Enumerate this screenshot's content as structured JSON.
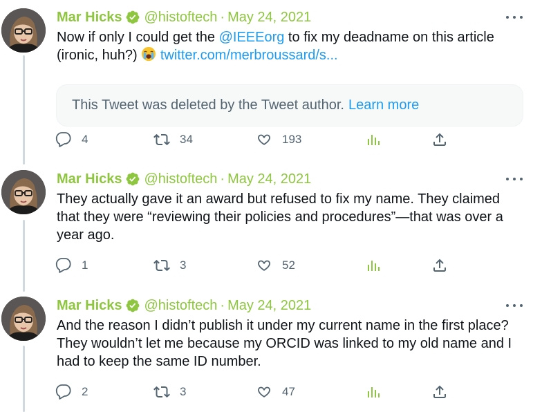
{
  "tweets": [
    {
      "name": "Mar Hicks",
      "handle": "@histoftech",
      "separator": "·",
      "date": "May 24, 2021",
      "text_parts": {
        "a": "Now if only I could get the ",
        "mention": "@IEEEorg",
        "b": " to fix my deadname on this article",
        "c": "(ironic, huh?) ",
        "emoji": "loudly-crying-face",
        "url": "twitter.com/merbroussard/s..."
      },
      "quote": {
        "text": "This Tweet was deleted by the Tweet author.",
        "link": "Learn more"
      },
      "replies": "4",
      "retweets": "34",
      "likes": "193"
    },
    {
      "name": "Mar Hicks",
      "handle": "@histoftech",
      "separator": "·",
      "date": "May 24, 2021",
      "text_lines": [
        "They actually gave it an award but refused to fix my name. They claimed",
        "that they were “reviewing their policies and procedures”—that was over a",
        "year ago."
      ],
      "replies": "1",
      "retweets": "3",
      "likes": "52"
    },
    {
      "name": "Mar Hicks",
      "handle": "@histoftech",
      "separator": "·",
      "date": "May 24, 2021",
      "text_lines": [
        "And the reason I didn’t publish it under my current name in the first place?",
        "They wouldn’t let me because my ORCID was linked to my old name and I",
        "had to keep the same ID number."
      ],
      "replies": "2",
      "retweets": "3",
      "likes": "47"
    }
  ],
  "colors": {
    "name": "#8ec63f",
    "verified": "#8ec63f",
    "link": "#1d9bf0",
    "secondary_text": "#536471",
    "thread_line": "#cfd9de",
    "analytics": "#8ec63f"
  },
  "icons": [
    "verified-badge-icon",
    "more-icon",
    "reply-icon",
    "retweet-icon",
    "like-icon",
    "analytics-icon",
    "share-icon",
    "loudly-crying-face-emoji"
  ]
}
